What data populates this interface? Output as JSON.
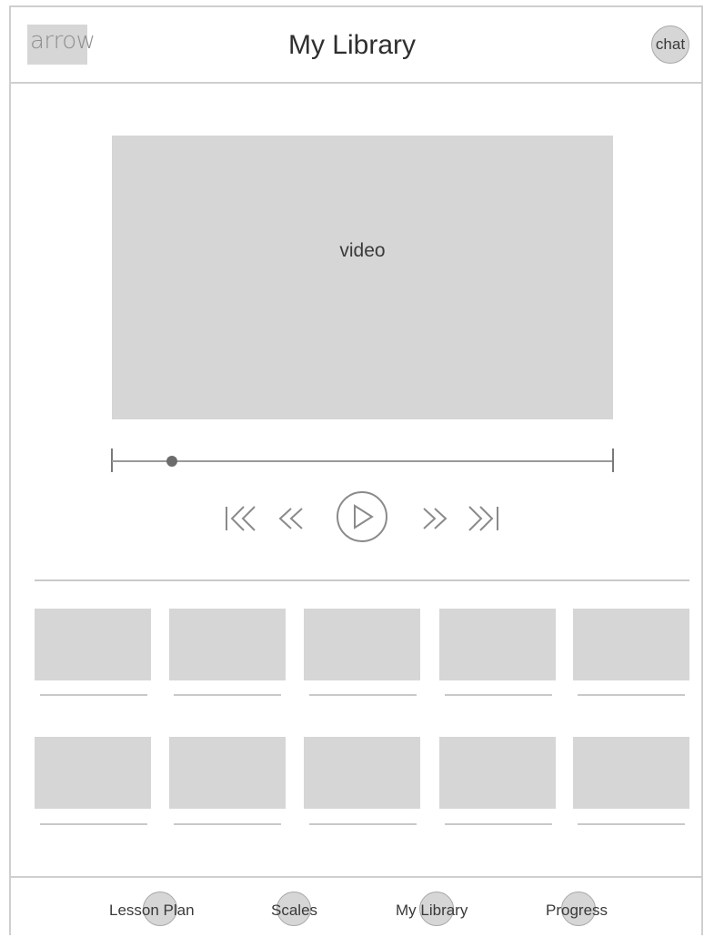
{
  "header": {
    "back_label": "arrow",
    "title": "My Library",
    "chat_label": "chat"
  },
  "player": {
    "video_label": "video",
    "progress": 0.12
  },
  "controls": [
    "skip-to-start",
    "rewind",
    "play",
    "fast-forward",
    "skip-to-end"
  ],
  "library": {
    "rows": 2,
    "columns": 5
  },
  "bottom_nav": {
    "items": [
      {
        "label": "Lesson Plan"
      },
      {
        "label": "Scales"
      },
      {
        "label": "My Library"
      },
      {
        "label": "Progress"
      }
    ]
  },
  "colors": {
    "placeholder": "#d6d6d6",
    "border": "#cfcfcf",
    "text": "#3a3a3a"
  }
}
